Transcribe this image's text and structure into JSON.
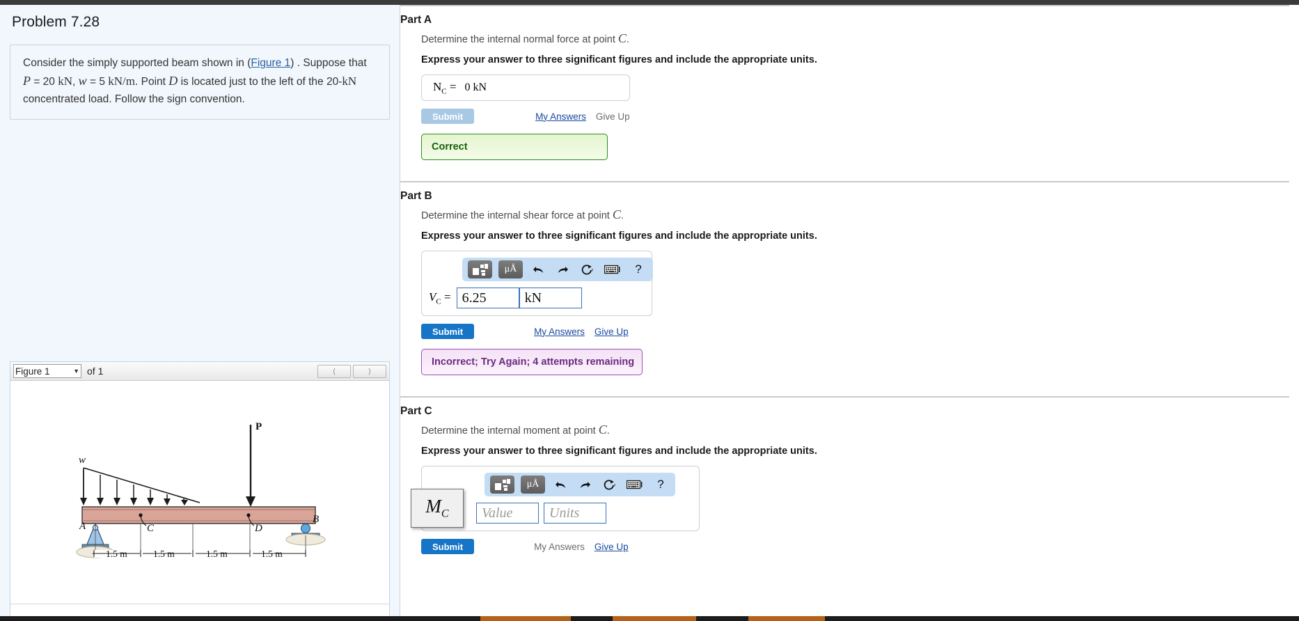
{
  "problem": {
    "title": "Problem 7.28",
    "text_pre": "Consider the simply supported beam shown in (",
    "figure_link": "Figure 1",
    "text_mid": ") . Suppose that",
    "P_sym": "P",
    "P_eq": "= 20",
    "P_unit": "kN",
    "comma": ",",
    "w_sym": "w",
    "w_eq": "= 5",
    "w_unit": "kN/m",
    "period": ". Point",
    "D_sym": "D",
    "text_tail": "is located just to the left of the 20-",
    "tail_unit": "kN",
    "text_end": "concentrated load. Follow the sign convention."
  },
  "figure": {
    "selected": "Figure 1",
    "of_label": "of 1",
    "prev_icon": "chevron-left-icon",
    "next_icon": "chevron-right-icon",
    "diagram": {
      "load_w_label": "w",
      "load_P_label": "P",
      "point_A": "A",
      "point_B": "B",
      "point_C": "C",
      "point_D": "D",
      "dims": [
        "1.5 m",
        "1.5 m",
        "1.5 m",
        "1.5 m"
      ],
      "beam_color": "#d9a598",
      "support_color": "#9fc6e8"
    }
  },
  "parts": [
    {
      "id": "A",
      "title": "Part A",
      "prompt_pre": "Determine the internal normal force at point",
      "prompt_sym": "C",
      "prompt_post": ".",
      "instruction": "Express your answer to three significant figures and include the appropriate units.",
      "answer_label": "N",
      "answer_sub": "C",
      "answer_eq": "=",
      "answer_value": "0 kN",
      "submit_label": "Submit",
      "submit_state": "disabled",
      "my_answers_label": "My Answers",
      "give_up_label": "Give Up",
      "give_up_link": false,
      "feedback": "Correct",
      "feedback_type": "correct"
    },
    {
      "id": "B",
      "title": "Part B",
      "prompt_pre": "Determine the internal shear force at point",
      "prompt_sym": "C",
      "prompt_post": ".",
      "instruction": "Express your answer to three significant figures and include the appropriate units.",
      "answer_label": "V",
      "answer_sub": "C",
      "answer_eq": "=",
      "value_field": "6.25",
      "units_field": "kN",
      "value_placeholder": "Value",
      "units_placeholder": "Units",
      "submit_label": "Submit",
      "submit_state": "active",
      "my_answers_label": "My Answers",
      "give_up_label": "Give Up",
      "give_up_link": true,
      "feedback": "Incorrect; Try Again; 4 attempts remaining",
      "feedback_type": "incorrect"
    },
    {
      "id": "C",
      "title": "Part C",
      "prompt_pre": "Determine the internal moment at point",
      "prompt_sym": "C",
      "prompt_post": ".",
      "instruction": "Express your answer to three significant figures and include the appropriate units.",
      "tooltip_label": "M",
      "tooltip_sub": "C",
      "value_field": "",
      "units_field": "",
      "value_placeholder": "Value",
      "units_placeholder": "Units",
      "submit_label": "Submit",
      "submit_state": "active",
      "my_answers_label": "My Answers",
      "give_up_label": "Give Up",
      "give_up_link": true,
      "feedback": "",
      "feedback_type": "none"
    }
  ],
  "toolbar": {
    "template_icon": "math-template-icon",
    "units_icon": "greek-units-icon",
    "units_glyph": "μÅ",
    "undo_icon": "undo-arrow-icon",
    "redo_icon": "redo-arrow-icon",
    "reset_icon": "reset-circular-arrow-icon",
    "keyboard_icon": "keyboard-icon",
    "help_icon": "help-question-icon",
    "help_glyph": "?"
  },
  "colors": {
    "accent_blue": "#1675c6",
    "link_blue": "#17479e",
    "correct_green": "#2c8a17",
    "incorrect_purple": "#9b52b0",
    "toolbar_blue": "#c4ddf5",
    "panel_bg": "#f2f7fd"
  }
}
